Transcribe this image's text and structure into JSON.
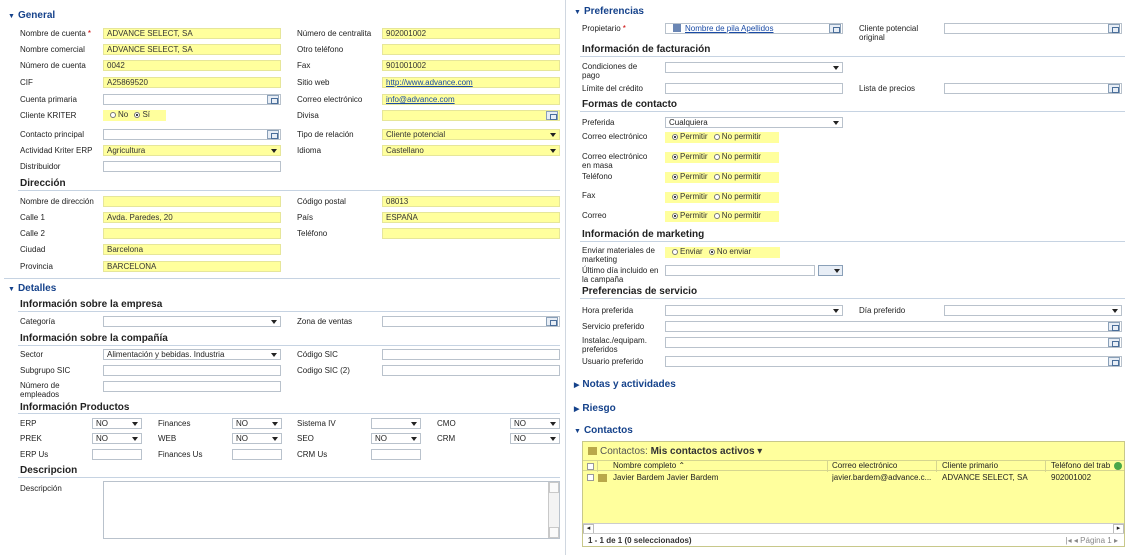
{
  "general": {
    "title": "General",
    "nombre_cuenta": {
      "label": "Nombre de cuenta",
      "value": "ADVANCE SELECT, SA"
    },
    "numero_centralita": {
      "label": "Número de centralita",
      "value": "902001002"
    },
    "nombre_comercial": {
      "label": "Nombre comercial",
      "value": "ADVANCE SELECT, SA"
    },
    "otro_telefono": {
      "label": "Otro teléfono",
      "value": ""
    },
    "numero_cuenta": {
      "label": "Número de cuenta",
      "value": "0042"
    },
    "fax": {
      "label": "Fax",
      "value": "901001002"
    },
    "cif": {
      "label": "CIF",
      "value": "A25869520"
    },
    "sitio_web": {
      "label": "Sitio web",
      "value": "http://www.advance.com"
    },
    "cuenta_primaria": {
      "label": "Cuenta primaria",
      "value": ""
    },
    "correo": {
      "label": "Correo electrónico",
      "value": "info@advance.com"
    },
    "cliente_kriter": {
      "label": "Cliente KRITER",
      "options": [
        "No",
        "Sí"
      ],
      "selected": "Sí"
    },
    "divisa": {
      "label": "Divisa",
      "value": ""
    },
    "contacto_principal": {
      "label": "Contacto principal",
      "value": ""
    },
    "tipo_relacion": {
      "label": "Tipo de relación",
      "value": "Cliente potencial"
    },
    "actividad": {
      "label": "Actividad Kriter ERP",
      "value": "Agricultura"
    },
    "idioma": {
      "label": "Idioma",
      "value": "Castellano"
    },
    "distribuidor": {
      "label": "Distribuidor",
      "value": ""
    }
  },
  "direccion": {
    "title": "Dirección",
    "nombre_dir": {
      "label": "Nombre de dirección",
      "value": ""
    },
    "cp": {
      "label": "Código postal",
      "value": "08013"
    },
    "calle1": {
      "label": "Calle 1",
      "value": "Avda. Paredes, 20"
    },
    "pais": {
      "label": "País",
      "value": "ESPAÑA"
    },
    "calle2": {
      "label": "Calle 2",
      "value": ""
    },
    "telefono": {
      "label": "Teléfono",
      "value": ""
    },
    "ciudad": {
      "label": "Ciudad",
      "value": "Barcelona"
    },
    "provincia": {
      "label": "Provincia",
      "value": "BARCELONA"
    }
  },
  "detalles": {
    "title": "Detalles",
    "info_empresa": "Información sobre la empresa",
    "categoria": {
      "label": "Categoría",
      "value": ""
    },
    "zona_ventas": {
      "label": "Zona de ventas",
      "value": ""
    },
    "info_compania": "Información sobre la compañía",
    "sector": {
      "label": "Sector",
      "value": "Alimentación y bebidas. Industria"
    },
    "codigo_sic": {
      "label": "Código SIC",
      "value": ""
    },
    "subgrupo_sic": {
      "label": "Subgrupo SIC",
      "value": ""
    },
    "codigo_sic2": {
      "label": "Codigo SIC (2)",
      "value": ""
    },
    "num_empleados": {
      "label": "Número de empleados",
      "value": ""
    },
    "info_productos": "Información Productos",
    "erp": {
      "label": "ERP",
      "value": "NO"
    },
    "finances": {
      "label": "Finances",
      "value": "NO"
    },
    "sistema_iv": {
      "label": "Sistema IV",
      "value": ""
    },
    "cmo": {
      "label": "CMO",
      "value": "NO"
    },
    "prek": {
      "label": "PREK",
      "value": "NO"
    },
    "web": {
      "label": "WEB",
      "value": "NO"
    },
    "seo": {
      "label": "SEO",
      "value": "NO"
    },
    "crm": {
      "label": "CRM",
      "value": "NO"
    },
    "erp_us": {
      "label": "ERP Us",
      "value": ""
    },
    "finances_us": {
      "label": "Finances Us",
      "value": ""
    },
    "crm_us": {
      "label": "CRM Us",
      "value": ""
    },
    "descripcion_title": "Descripcion",
    "descripcion": {
      "label": "Descripción",
      "value": ""
    }
  },
  "preferencias": {
    "title": "Preferencias",
    "propietario": {
      "label": "Propietario",
      "value": "Nombre de pila Apellidos"
    },
    "cliente_potencial": {
      "label": "Cliente potencial original",
      "value": ""
    },
    "info_facturacion": "Información de facturación",
    "condiciones": {
      "label": "Condiciones de pago",
      "value": ""
    },
    "limite": {
      "label": "Límite del crédito",
      "value": ""
    },
    "lista_precios": {
      "label": "Lista de precios",
      "value": ""
    },
    "formas_contacto": "Formas de contacto",
    "preferida": {
      "label": "Preferida",
      "value": "Cualquiera"
    },
    "permit_options": [
      "Permitir",
      "No permitir"
    ],
    "correo_e": {
      "label": "Correo electrónico",
      "selected": "Permitir"
    },
    "correo_masa": {
      "label": "Correo electrónico en masa",
      "selected": "Permitir"
    },
    "telefono": {
      "label": "Teléfono",
      "selected": "Permitir"
    },
    "fax": {
      "label": "Fax",
      "selected": "Permitir"
    },
    "correo": {
      "label": "Correo",
      "selected": "Permitir"
    },
    "info_marketing": "Información de marketing",
    "enviar": {
      "label": "Enviar materiales de marketing",
      "options": [
        "Enviar",
        "No enviar"
      ],
      "selected": "No enviar"
    },
    "ultimo_dia": {
      "label": "Último día incluido en la campaña",
      "value": ""
    },
    "pref_servicio": "Preferencias de servicio",
    "hora": {
      "label": "Hora preferida",
      "value": ""
    },
    "dia": {
      "label": "Día preferido",
      "value": ""
    },
    "servicio": {
      "label": "Servicio preferido",
      "value": ""
    },
    "instalac": {
      "label": "Instalac./equipam. preferidos",
      "value": ""
    },
    "usuario": {
      "label": "Usuario preferido",
      "value": ""
    }
  },
  "notas": "Notas y actividades",
  "riesgo": "Riesgo",
  "contactos": {
    "title": "Contactos",
    "view_prefix": "Contactos:",
    "view_name": "Mis contactos activos",
    "columns": [
      "Nombre completo",
      "Correo electrónico",
      "Cliente primario",
      "Teléfono del trab"
    ],
    "rows": [
      {
        "nombre": "Javier Bardem Javier Bardem",
        "correo": "javier.bardem@advance.c...",
        "cliente": "ADVANCE SELECT, SA",
        "telefono": "902001002"
      }
    ],
    "footer": "1 - 1  de 1 (0 seleccionados)",
    "page": "Página 1"
  }
}
